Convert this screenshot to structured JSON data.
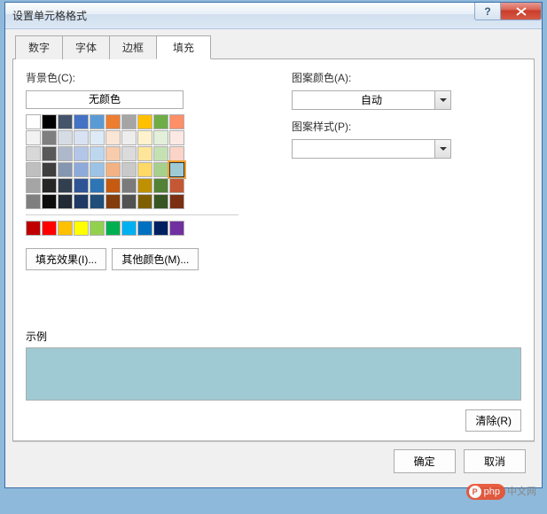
{
  "title": "设置单元格格式",
  "tabs": [
    "数字",
    "字体",
    "边框",
    "填充"
  ],
  "activeTab": 3,
  "labels": {
    "bgcolor": "背景色(C):",
    "nocolor": "无颜色",
    "patterncolor": "图案颜色(A):",
    "patternstyle": "图案样式(P):",
    "auto": "自动",
    "filleffects": "填充效果(I)...",
    "morecolors": "其他颜色(M)...",
    "sample": "示例",
    "clear": "清除(R)",
    "ok": "确定",
    "cancel": "取消"
  },
  "theme_colors": [
    [
      "#ffffff",
      "#000000",
      "#44546a",
      "#4472c4",
      "#5b9bd5",
      "#ed7d31",
      "#a5a5a5",
      "#ffc000",
      "#70ad47",
      "#ff8f67"
    ],
    [
      "#f2f2f2",
      "#7f7f7f",
      "#d6dce4",
      "#d9e2f3",
      "#deebf6",
      "#fbe5d5",
      "#ededed",
      "#fff2cc",
      "#e2efd9",
      "#fde9e3"
    ],
    [
      "#d8d8d8",
      "#595959",
      "#adb9ca",
      "#b4c6e7",
      "#bdd7ee",
      "#f7cbac",
      "#dbdbdb",
      "#fee599",
      "#c5e0b3",
      "#fbd3c7"
    ],
    [
      "#bfbfbf",
      "#3f3f3f",
      "#8496b0",
      "#8eaadb",
      "#9cc3e5",
      "#f4b183",
      "#c9c9c9",
      "#ffd965",
      "#a8d08d",
      "#9fcad4"
    ],
    [
      "#a5a5a5",
      "#262626",
      "#323f4f",
      "#2f5496",
      "#2e75b5",
      "#c55a11",
      "#7b7b7b",
      "#bf9000",
      "#538135",
      "#c45835"
    ],
    [
      "#7f7f7f",
      "#0c0c0c",
      "#222a35",
      "#1f3864",
      "#1e4e79",
      "#833c0b",
      "#525252",
      "#7f6000",
      "#375623",
      "#7b3013"
    ]
  ],
  "standard_colors": [
    "#c00000",
    "#ff0000",
    "#ffc000",
    "#ffff00",
    "#92d050",
    "#00b050",
    "#00b0f0",
    "#0070c0",
    "#002060",
    "#7030a0"
  ],
  "selected_swatch": [
    3,
    9
  ],
  "sample_color": "#9fcad4",
  "watermark": {
    "brand": "php",
    "text": "中文网"
  }
}
